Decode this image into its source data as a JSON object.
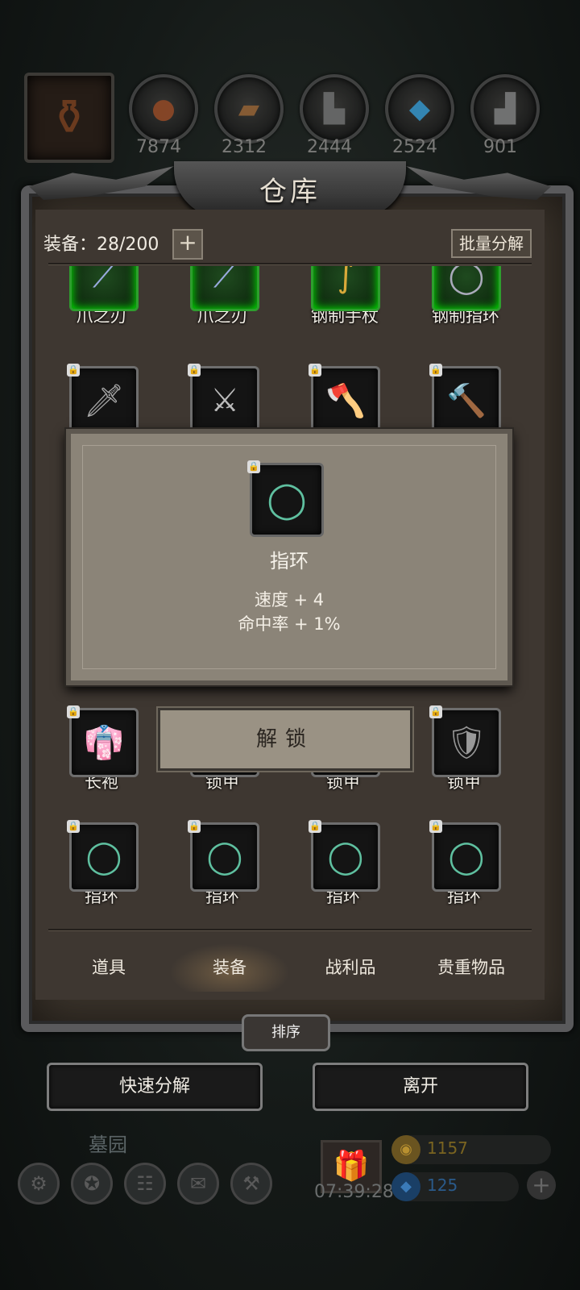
{
  "resources": [
    {
      "icon": "meat-icon",
      "count": "7874"
    },
    {
      "icon": "wood-icon",
      "count": "2312"
    },
    {
      "icon": "stone-icon",
      "count": "2444"
    },
    {
      "icon": "crystal-icon",
      "count": "2524"
    },
    {
      "icon": "iron-icon",
      "count": "901"
    }
  ],
  "warehouse": {
    "title": "仓库",
    "equip_label": "装备：28/200",
    "add_label": "+",
    "batch_label": "批量分解"
  },
  "items": [
    {
      "name": "爪之刃",
      "icon": "claw-blade-icon"
    },
    {
      "name": "爪之刃",
      "icon": "claw-blade-icon"
    },
    {
      "name": "钢制手杖",
      "icon": "steel-staff-icon"
    },
    {
      "name": "钢制指环",
      "icon": "steel-ring-icon"
    },
    {
      "name": "",
      "icon": "short-sword-icon"
    },
    {
      "name": "",
      "icon": "great-sword-icon"
    },
    {
      "name": "",
      "icon": "axe-icon"
    },
    {
      "name": "",
      "icon": "hammer-icon"
    },
    {
      "name": "长袍",
      "icon": "robe-icon"
    },
    {
      "name": "锁甲",
      "icon": "chainmail-icon"
    },
    {
      "name": "锁甲",
      "icon": "chainmail-icon"
    },
    {
      "name": "锁甲",
      "icon": "chainmail-icon"
    },
    {
      "name": "指环",
      "icon": "ring-icon"
    },
    {
      "name": "指环",
      "icon": "ring-icon"
    },
    {
      "name": "指环",
      "icon": "ring-icon"
    },
    {
      "name": "指环",
      "icon": "ring-icon"
    }
  ],
  "detail": {
    "icon": "ring-icon",
    "name": "指环",
    "stat1": "速度 + 4",
    "stat2": "命中率 + 1%"
  },
  "unlock_label": "解锁",
  "tabs": [
    {
      "label": "道具"
    },
    {
      "label": "装备",
      "active": true
    },
    {
      "label": "战利品"
    },
    {
      "label": "贵重物品"
    }
  ],
  "sort_label": "排序",
  "quick_decompose_label": "快速分解",
  "leave_label": "离开",
  "hud": {
    "location": "墓园",
    "timer": "07:39:28",
    "gold": "1157",
    "gems": "125"
  },
  "colors": {
    "panel": "#3e3731",
    "popup": "#8b8478",
    "rare_green": "#2e9e2e"
  }
}
